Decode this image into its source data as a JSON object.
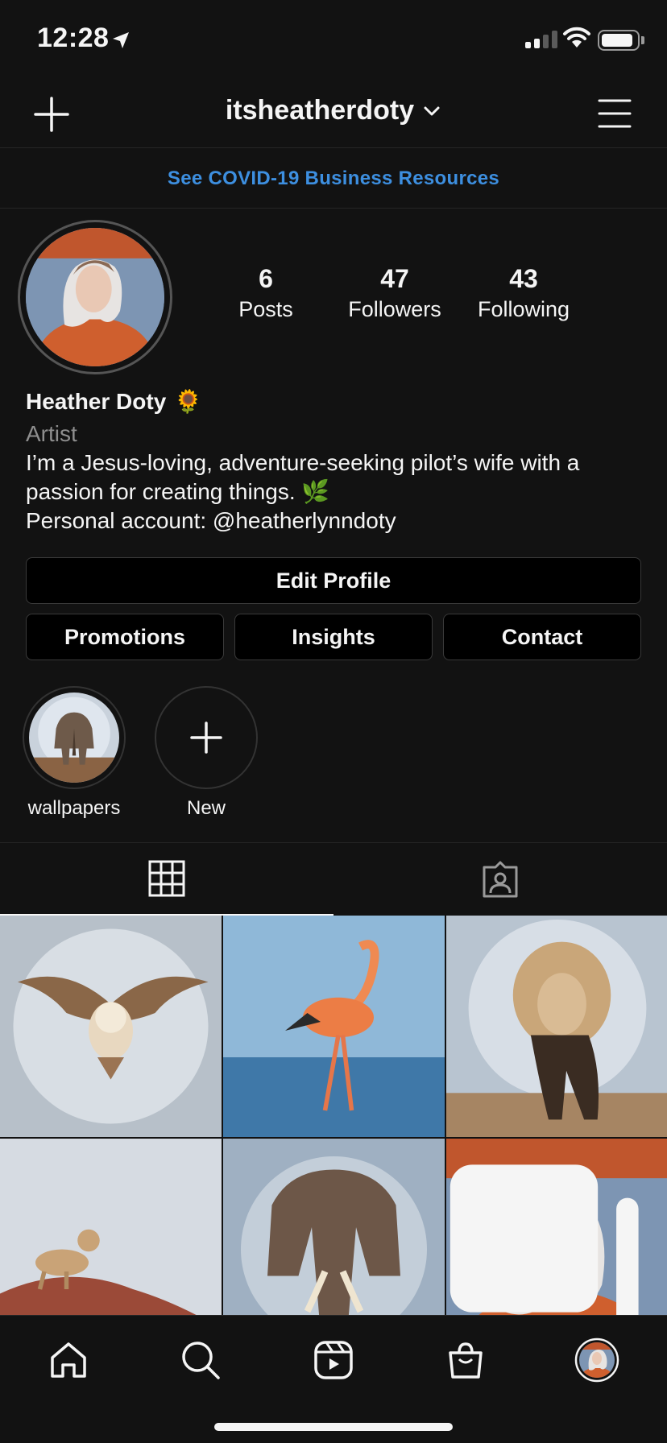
{
  "status_bar": {
    "time": "12:28"
  },
  "header": {
    "username": "itsheatherdoty"
  },
  "banner": {
    "text": "See COVID-19 Business Resources"
  },
  "profile": {
    "stats": [
      {
        "value": "6",
        "label": "Posts"
      },
      {
        "value": "47",
        "label": "Followers"
      },
      {
        "value": "43",
        "label": "Following"
      }
    ],
    "name": "Heather Doty",
    "name_emoji": "🌻",
    "category": "Artist",
    "bio_line1": "I’m a Jesus-loving, adventure-seeking pilot’s wife with a passion for creating things. 🌿",
    "bio_line2": "Personal account: @heatherlynndoty"
  },
  "buttons": {
    "edit": "Edit Profile",
    "promotions": "Promotions",
    "insights": "Insights",
    "contact": "Contact"
  },
  "highlights": [
    {
      "label": "wallpapers"
    },
    {
      "label": "New"
    }
  ],
  "tabs": {
    "active": "grid"
  },
  "posts": [
    {
      "subject": "owl"
    },
    {
      "subject": "flamingo"
    },
    {
      "subject": "lion"
    },
    {
      "subject": "cheetah"
    },
    {
      "subject": "elephant"
    },
    {
      "subject": "portrait",
      "multiple": true
    }
  ],
  "colors": {
    "background": "#121212",
    "link": "#3d8fe0",
    "divider": "#262626",
    "secondary_text": "#8e8e8e"
  }
}
